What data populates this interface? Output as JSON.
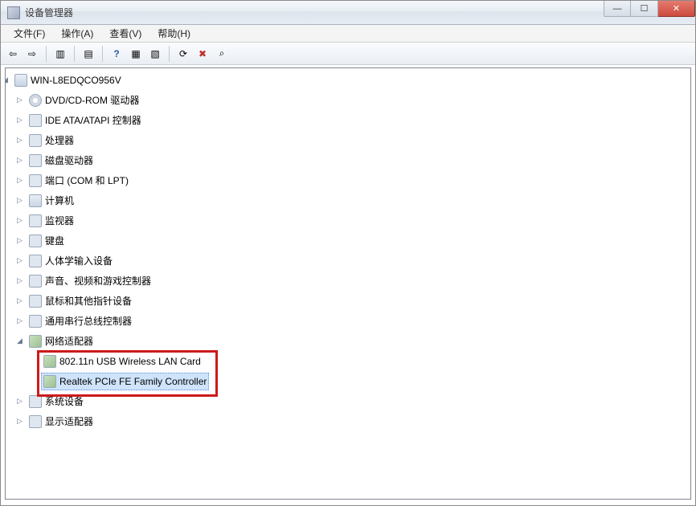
{
  "window": {
    "title": "设备管理器"
  },
  "menu": {
    "file": "文件(F)",
    "action": "操作(A)",
    "view": "查看(V)",
    "help": "帮助(H)"
  },
  "tree": {
    "root": "WIN-L8EDQCO956V",
    "items": [
      {
        "label": "DVD/CD-ROM 驱动器",
        "icon": "disc"
      },
      {
        "label": "IDE ATA/ATAPI 控制器",
        "icon": "generic"
      },
      {
        "label": "处理器",
        "icon": "generic"
      },
      {
        "label": "磁盘驱动器",
        "icon": "generic"
      },
      {
        "label": "端口 (COM 和 LPT)",
        "icon": "generic"
      },
      {
        "label": "计算机",
        "icon": "computer"
      },
      {
        "label": "监视器",
        "icon": "generic"
      },
      {
        "label": "键盘",
        "icon": "generic"
      },
      {
        "label": "人体学输入设备",
        "icon": "generic"
      },
      {
        "label": "声音、视频和游戏控制器",
        "icon": "generic"
      },
      {
        "label": "鼠标和其他指针设备",
        "icon": "generic"
      },
      {
        "label": "通用串行总线控制器",
        "icon": "generic"
      },
      {
        "label": "网络适配器",
        "icon": "net",
        "expanded": true,
        "children": [
          {
            "label": "802.11n USB Wireless LAN Card",
            "icon": "net"
          },
          {
            "label": "Realtek PCIe FE Family Controller",
            "icon": "net",
            "selected": true
          }
        ]
      },
      {
        "label": "系统设备",
        "icon": "generic"
      },
      {
        "label": "显示适配器",
        "icon": "generic"
      }
    ]
  }
}
